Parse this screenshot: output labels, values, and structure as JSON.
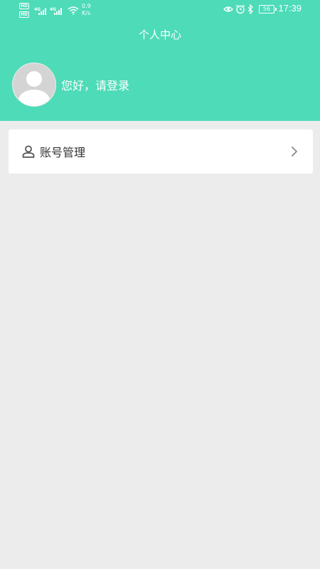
{
  "status_bar": {
    "hd_badge_1": "HD",
    "hd_badge_2": "HD",
    "signal_tag_1": "4G",
    "signal_tag_2": "4G",
    "net_speed_value": "0.9",
    "net_speed_unit": "K/s",
    "battery_level": "56",
    "time": "17:39",
    "icons": [
      "eye-icon",
      "alarm-icon",
      "bluetooth-icon"
    ]
  },
  "header": {
    "title": "个人中心",
    "login_prompt": "您好，请登录",
    "background_color": "#4ddbb8"
  },
  "menu": {
    "items": [
      {
        "label": "账号管理",
        "icon": "user-icon"
      }
    ]
  }
}
